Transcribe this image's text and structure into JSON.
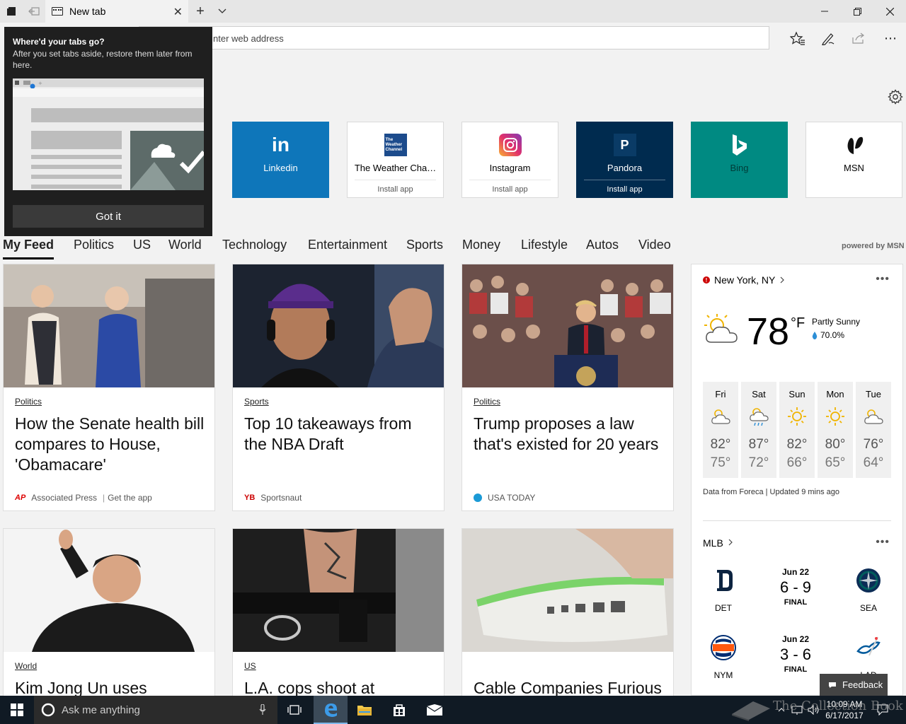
{
  "browser": {
    "tab_title": "New tab",
    "address_placeholder": "Search or enter web address",
    "address_visible_text": "nter web address"
  },
  "top_sites": [
    {
      "name": "Linkedin",
      "install": "",
      "logo": "linkedin-logo",
      "bg": "#0e76ba"
    },
    {
      "name": "The Weather Cha…",
      "install": "Install app",
      "logo": "weather-channel-logo",
      "bg": "#ffffff",
      "logo_text": [
        "The",
        "Weather",
        "Channel"
      ]
    },
    {
      "name": "Instagram",
      "install": "Install app",
      "logo": "instagram-logo",
      "bg": "#ffffff"
    },
    {
      "name": "Pandora",
      "install": "Install app",
      "logo": "pandora-logo",
      "bg": "#002b4f",
      "logo_text": "P"
    },
    {
      "name": "Bing",
      "install": "",
      "logo": "bing-logo",
      "bg": "#008a82"
    },
    {
      "name": "MSN",
      "install": "",
      "logo": "msn-logo",
      "bg": "#ffffff"
    }
  ],
  "feed_nav": [
    "My Feed",
    "Politics",
    "US",
    "World",
    "Technology",
    "Entertainment",
    "Sports",
    "Money",
    "Lifestyle",
    "Autos",
    "Video"
  ],
  "powered_by": "powered by MSN",
  "articles": [
    {
      "category": "Politics",
      "headline": "How the Senate health bill compares to House, 'Obamacare'",
      "source": "Associated Press",
      "extra": "Get the app",
      "src_icon": "AP"
    },
    {
      "category": "Sports",
      "headline": "Top 10 takeaways from the NBA Draft",
      "source": "Sportsnaut",
      "extra": "",
      "src_icon": "YB"
    },
    {
      "category": "Politics",
      "headline": "Trump proposes a law that's existed for 20 years",
      "source": "USA TODAY",
      "extra": "",
      "src_icon": ""
    },
    {
      "category": "World",
      "headline": "Kim Jong Un uses",
      "source": "",
      "extra": ""
    },
    {
      "category": "US",
      "headline": "L.A. cops shoot at",
      "source": "",
      "extra": ""
    },
    {
      "category": "",
      "headline": "Cable Companies Furious",
      "source": "",
      "extra": ""
    }
  ],
  "weather": {
    "location": "New York, NY",
    "temp": "78",
    "unit": "°F",
    "condition": "Partly Sunny",
    "humidity": "70.0%",
    "forecast": [
      {
        "day": "Fri",
        "high": "82°",
        "low": "75°",
        "icon": "partly-sunny-icon"
      },
      {
        "day": "Sat",
        "high": "87°",
        "low": "72°",
        "icon": "rain-icon"
      },
      {
        "day": "Sun",
        "high": "82°",
        "low": "66°",
        "icon": "sunny-icon"
      },
      {
        "day": "Mon",
        "high": "80°",
        "low": "65°",
        "icon": "sunny-icon"
      },
      {
        "day": "Tue",
        "high": "76°",
        "low": "64°",
        "icon": "partly-sunny-icon"
      }
    ],
    "source": "Data from Foreca | Updated 9 mins ago"
  },
  "mlb": {
    "title": "MLB",
    "games": [
      {
        "home": "DET",
        "away": "SEA",
        "date": "Jun 22",
        "score": "6 - 9",
        "status": "FINAL"
      },
      {
        "home": "NYM",
        "away": "LAD",
        "date": "Jun 22",
        "score": "3 - 6",
        "status": "FINAL"
      }
    ]
  },
  "popup": {
    "title": "Where'd your tabs go?",
    "body": "After you set tabs aside, restore them later from here.",
    "button": "Got it"
  },
  "feedback": "Feedback",
  "taskbar": {
    "search_text": "Ask me anything",
    "time": "10:09 AM",
    "date": "6/17/2017",
    "watermark": "The Collection Book"
  },
  "colors": {
    "accent": "#0078d7",
    "taskbar": "#101a24",
    "popup": "#1f1f1f"
  }
}
